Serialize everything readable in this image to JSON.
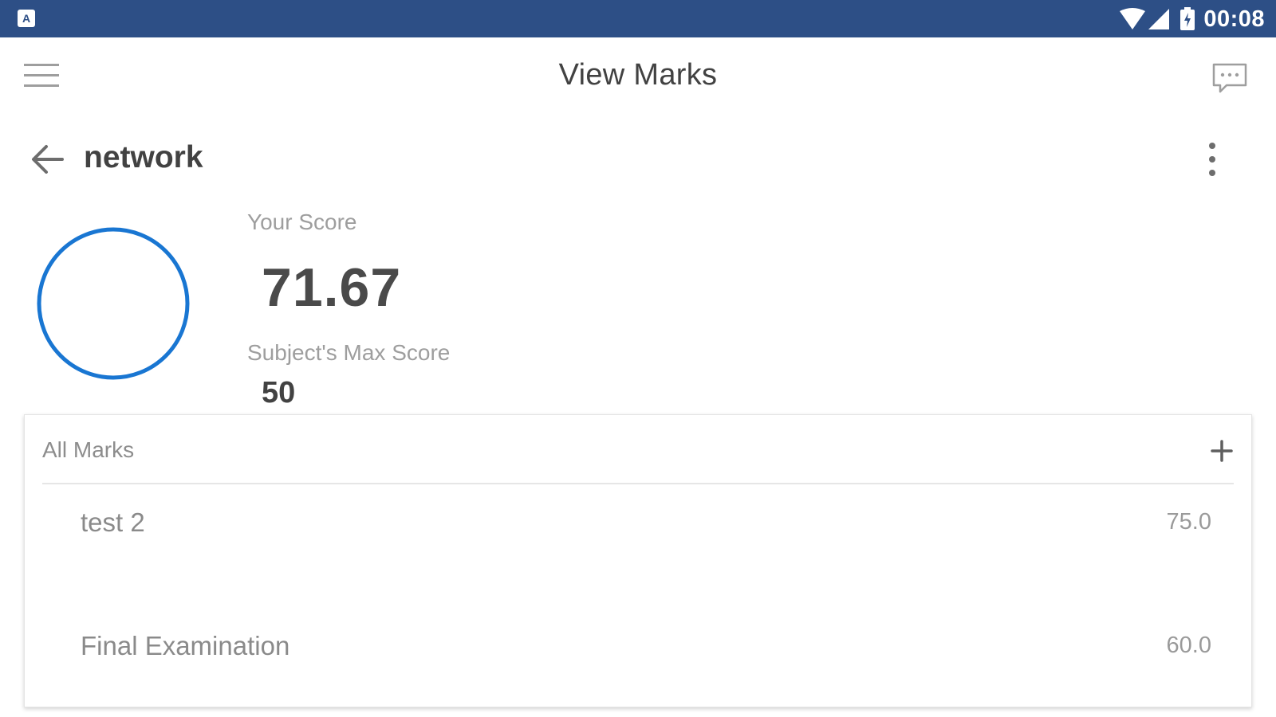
{
  "status_bar": {
    "app_icon": "a-notification-icon",
    "time": "00:08",
    "background": "#2d4f86"
  },
  "app_bar": {
    "title": "View Marks",
    "menu_icon": "hamburger-menu-icon",
    "chat_icon": "chat-bubble-icon"
  },
  "subject": {
    "name": "network",
    "back_icon": "arrow-left-icon",
    "more_icon": "more-vertical-icon"
  },
  "score": {
    "label": "Your Score",
    "value": "71.67",
    "max_label": "Subject's Max Score",
    "max_value": "50",
    "ring_color": "#1976d2"
  },
  "marks": {
    "title": "All Marks",
    "add_icon": "plus-icon",
    "items": [
      {
        "name": "test 2",
        "score": "75.0"
      },
      {
        "name": "Final Examination",
        "score": "60.0"
      }
    ]
  }
}
